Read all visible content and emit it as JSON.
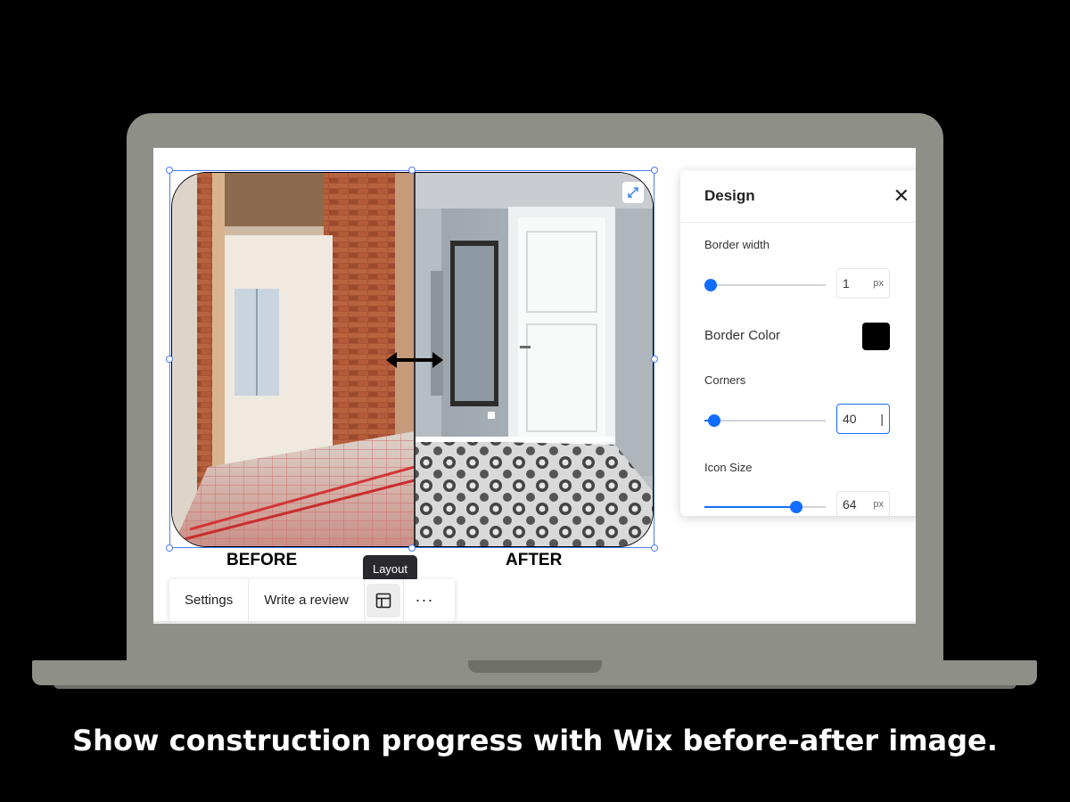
{
  "widget": {
    "before_caption": "BEFORE",
    "after_caption": "AFTER",
    "tooltip": "Layout",
    "toolbar": {
      "settings": "Settings",
      "write_review": "Write a review",
      "more": "···"
    },
    "icons": {
      "expand": "expand-icon",
      "slider": "double-arrow-icon",
      "layout": "layout-icon"
    }
  },
  "design_panel": {
    "title": "Design",
    "close": "✕",
    "border_width": {
      "label": "Border width",
      "value": "1",
      "unit": "px",
      "slider": 0.05
    },
    "border_color": {
      "label": "Border Color",
      "color": "#000000"
    },
    "corners": {
      "label": "Corners",
      "value": "40",
      "slider": 0.08
    },
    "icon_size": {
      "label": "Icon Size",
      "value": "64",
      "unit": "px",
      "slider": 0.76
    }
  },
  "colors": {
    "accent": "#116dff",
    "selection": "#4d7cf4"
  },
  "tagline": "Show construction progress with Wix before-after image."
}
